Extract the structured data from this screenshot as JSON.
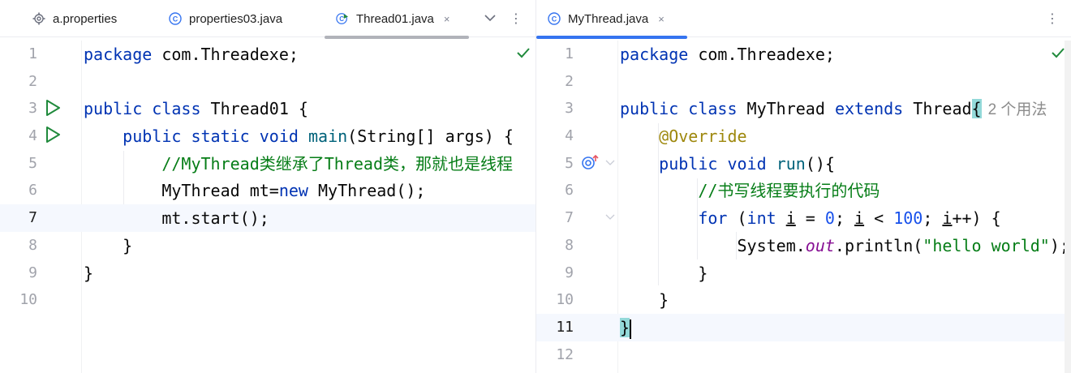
{
  "left": {
    "tabs": [
      {
        "label": "a.properties",
        "icon": "gear-icon"
      },
      {
        "label": "properties03.java",
        "icon": "java-class-icon"
      },
      {
        "label": "Thread01.java",
        "icon": "java-run-class-icon",
        "close": "×",
        "active": true
      }
    ],
    "buttons": {
      "more_tabs": "chevron-down-icon",
      "options": "⋮"
    },
    "lines": [
      {
        "n": "1"
      },
      {
        "n": "2"
      },
      {
        "n": "3"
      },
      {
        "n": "4"
      },
      {
        "n": "5"
      },
      {
        "n": "6"
      },
      {
        "n": "7"
      },
      {
        "n": "8"
      },
      {
        "n": "9"
      },
      {
        "n": "10"
      }
    ],
    "code": {
      "l1_kw": "package",
      "l1_rest": " com.Threadexe;",
      "l3_kw1": "public",
      "l3_kw2": "class",
      "l3_rest": " Thread01 {",
      "l4_indent": "    ",
      "l4_kw1": "public",
      "l4_kw2": "static",
      "l4_kw3": "void",
      "l4_fn": "main",
      "l4_rest": "(String[] args) {",
      "l5_indent": "        ",
      "l5_comment": "//MyThread类继承了Thread类，那就也是线程",
      "l6_indent": "        ",
      "l6_a": "MyThread mt=",
      "l6_kw": "new",
      "l6_b": " MyThread();",
      "l7_indent": "        ",
      "l7_text": "mt.start();",
      "l8_indent": "    ",
      "l8_text": "}",
      "l9_text": "}"
    }
  },
  "right": {
    "tabs": [
      {
        "label": "MyThread.java",
        "icon": "java-class-icon",
        "close": "×",
        "active": true
      }
    ],
    "buttons": {
      "options": "⋮"
    },
    "lines": [
      {
        "n": "1"
      },
      {
        "n": "2"
      },
      {
        "n": "3"
      },
      {
        "n": "4"
      },
      {
        "n": "5"
      },
      {
        "n": "6"
      },
      {
        "n": "7"
      },
      {
        "n": "8"
      },
      {
        "n": "9"
      },
      {
        "n": "10"
      },
      {
        "n": "11"
      },
      {
        "n": "12"
      }
    ],
    "code": {
      "l1_kw": "package",
      "l1_rest": " com.Threadexe;",
      "l3_kw1": "public",
      "l3_kw2": "class",
      "l3_name": " MyThread ",
      "l3_kw3": "extends",
      "l3_rest": " Thread",
      "l3_brace": "{",
      "l3_hint": "2 个用法",
      "l4_indent": "    ",
      "l4_ann": "@Override",
      "l5_indent": "    ",
      "l5_kw1": "public",
      "l5_kw2": "void",
      "l5_fn": "run",
      "l5_rest": "(){",
      "l6_indent": "        ",
      "l6_comment": "//书写线程要执行的代码",
      "l7_indent": "        ",
      "l7_kw1": "for",
      "l7_a": " (",
      "l7_kw2": "int",
      "l7_sp": " ",
      "l7_i1": "i",
      "l7_b": " = ",
      "l7_n1": "0",
      "l7_c": "; ",
      "l7_i2": "i",
      "l7_d": " < ",
      "l7_n2": "100",
      "l7_e": "; ",
      "l7_i3": "i",
      "l7_f": "++) {",
      "l8_indent": "            ",
      "l8_a": "System.",
      "l8_field": "out",
      "l8_b": ".println(",
      "l8_str": "\"hello world\"",
      "l8_c": ");",
      "l9_indent": "        ",
      "l9_text": "}",
      "l10_indent": "    ",
      "l10_text": "}",
      "l11_brace": "}"
    }
  },
  "colors": {
    "keyword": "#0033b3",
    "function": "#00627a",
    "comment": "#8c8c8c",
    "annotation": "#9e880d",
    "number": "#1750eb",
    "string": "#067d17",
    "static_field": "#871094",
    "active_tab_right": "#3574f0",
    "active_tab_left": "#b1b3ba",
    "run_icon": "#208a3c",
    "check_icon": "#208a3c",
    "brace_highlight": "#93d9d9"
  }
}
